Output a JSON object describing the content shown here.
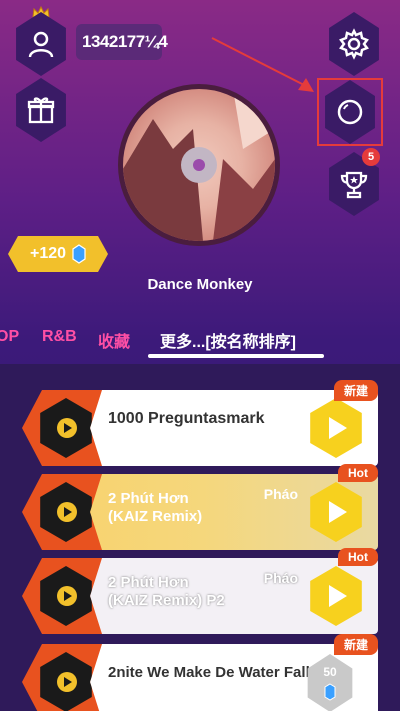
{
  "header": {
    "score": "1342177¼4",
    "notification_count": "5"
  },
  "now_playing": {
    "title": "Dance Monkey",
    "coins": "+120"
  },
  "tabs": [
    {
      "label": "OP"
    },
    {
      "label": "R&B"
    },
    {
      "label": "收藏"
    },
    {
      "label": "更多...[按名称排序]"
    }
  ],
  "songs": [
    {
      "name": "1000 Preguntasmark",
      "badge": "新建",
      "type": "play"
    },
    {
      "name": "2 Phút Hơn\n(KAIZ Remix)",
      "artist": "Pháo",
      "badge": "Hot",
      "type": "play"
    },
    {
      "name": "2 Phút Hơn\n(KAIZ Remix) P2",
      "artist": "Pháo",
      "badge": "Hot",
      "type": "play"
    },
    {
      "name": "2nite We Make De Water Fall",
      "badge": "新建",
      "type": "locked",
      "cost": "50"
    }
  ],
  "colors": {
    "accent_pink": "#ff4fa5",
    "play_yellow": "#f7d11e",
    "badge_orange": "#e8521f",
    "highlight_red": "#e53b3b"
  }
}
